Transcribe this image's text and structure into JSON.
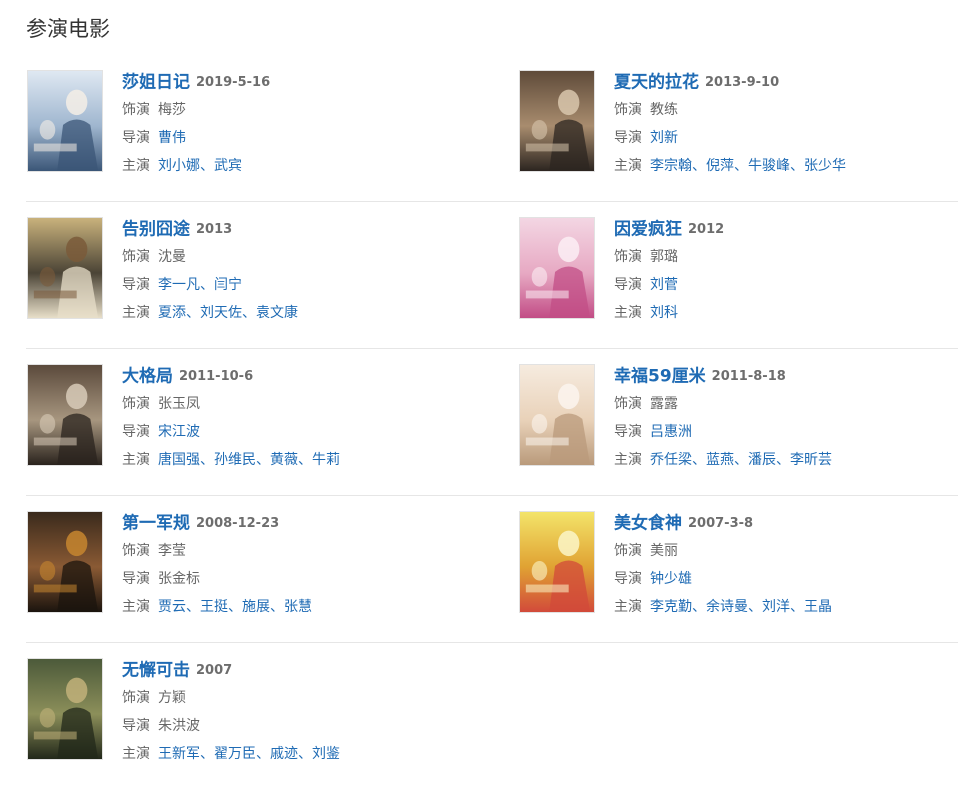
{
  "section": {
    "title": "参演电影"
  },
  "films": [
    {
      "title": "莎姐日记",
      "date": "2019-5-16",
      "role_label": "饰演",
      "role": "梅莎",
      "director_label": "导演",
      "directors": [
        "曹伟"
      ],
      "directors_linked": true,
      "cast_label": "主演",
      "cast": [
        "刘小娜",
        "武宾"
      ],
      "poster_colors": [
        "#dfe8f2",
        "#9fb6cf",
        "#3b5677",
        "#f5efe6"
      ]
    },
    {
      "title": "夏天的拉花",
      "date": "2013-9-10",
      "role_label": "饰演",
      "role": "教练",
      "director_label": "导演",
      "directors": [
        "刘新"
      ],
      "directors_linked": true,
      "cast_label": "主演",
      "cast": [
        "李宗翰",
        "倪萍",
        "牛骏峰",
        "张少华"
      ],
      "poster_colors": [
        "#5f4b3a",
        "#a88c6e",
        "#2c2520",
        "#d9c7ad"
      ]
    },
    {
      "title": "告别囧途",
      "date": "2013",
      "role_label": "饰演",
      "role": "沈曼",
      "director_label": "导演",
      "directors": [
        "李一凡",
        "闫宁"
      ],
      "directors_linked": true,
      "cast_label": "主演",
      "cast": [
        "夏添",
        "刘天佐",
        "袁文康"
      ],
      "poster_colors": [
        "#c9b27c",
        "#4b4436",
        "#e8dfc9",
        "#7a5a3a"
      ]
    },
    {
      "title": "因爱疯狂",
      "date": "2012",
      "role_label": "饰演",
      "role": "郭璐",
      "director_label": "导演",
      "directors": [
        "刘菅"
      ],
      "directors_linked": true,
      "cast_label": "主演",
      "cast": [
        "刘科"
      ],
      "poster_colors": [
        "#f3d6e3",
        "#e7a9c3",
        "#c24d86",
        "#fbeff4"
      ]
    },
    {
      "title": "大格局",
      "date": "2011-10-6",
      "role_label": "饰演",
      "role": "张玉凤",
      "director_label": "导演",
      "directors": [
        "宋江波"
      ],
      "directors_linked": true,
      "cast_label": "主演",
      "cast": [
        "唐国强",
        "孙维民",
        "黄薇",
        "牛莉"
      ],
      "poster_colors": [
        "#5b4a3c",
        "#a7967f",
        "#2a231d",
        "#d8cbb8"
      ]
    },
    {
      "title": "幸福59厘米",
      "date": "2011-8-18",
      "role_label": "饰演",
      "role": "露露",
      "director_label": "导演",
      "directors": [
        "吕惠洲"
      ],
      "directors_linked": true,
      "cast_label": "主演",
      "cast": [
        "乔任梁",
        "蓝燕",
        "潘辰",
        "李昕芸"
      ],
      "poster_colors": [
        "#f6ebdf",
        "#e9d2b9",
        "#b99a7b",
        "#fbf5ee"
      ]
    },
    {
      "title": "第一军规",
      "date": "2008-12-23",
      "role_label": "饰演",
      "role": "李莹",
      "director_label": "导演",
      "directors": [
        "张金标"
      ],
      "directors_linked": false,
      "cast_label": "主演",
      "cast": [
        "贾云",
        "王挺",
        "施展",
        "张慧"
      ],
      "poster_colors": [
        "#3a2a1c",
        "#8a5a34",
        "#1b140e",
        "#c7862f"
      ]
    },
    {
      "title": "美女食神",
      "date": "2007-3-8",
      "role_label": "饰演",
      "role": "美丽",
      "director_label": "导演",
      "directors": [
        "钟少雄"
      ],
      "directors_linked": true,
      "cast_label": "主演",
      "cast": [
        "李克勤",
        "余诗曼",
        "刘洋",
        "王晶"
      ],
      "poster_colors": [
        "#f3e46a",
        "#e0a233",
        "#d24a3a",
        "#fbf6c8"
      ]
    },
    {
      "title": "无懈可击",
      "date": "2007",
      "role_label": "饰演",
      "role": "方颖",
      "director_label": "导演",
      "directors": [
        "朱洪波"
      ],
      "directors_linked": false,
      "cast_label": "主演",
      "cast": [
        "王新军",
        "翟万臣",
        "戚迹",
        "刘鉴"
      ],
      "poster_colors": [
        "#4c5a3a",
        "#8c8f5a",
        "#22281a",
        "#c2b27a"
      ]
    }
  ]
}
